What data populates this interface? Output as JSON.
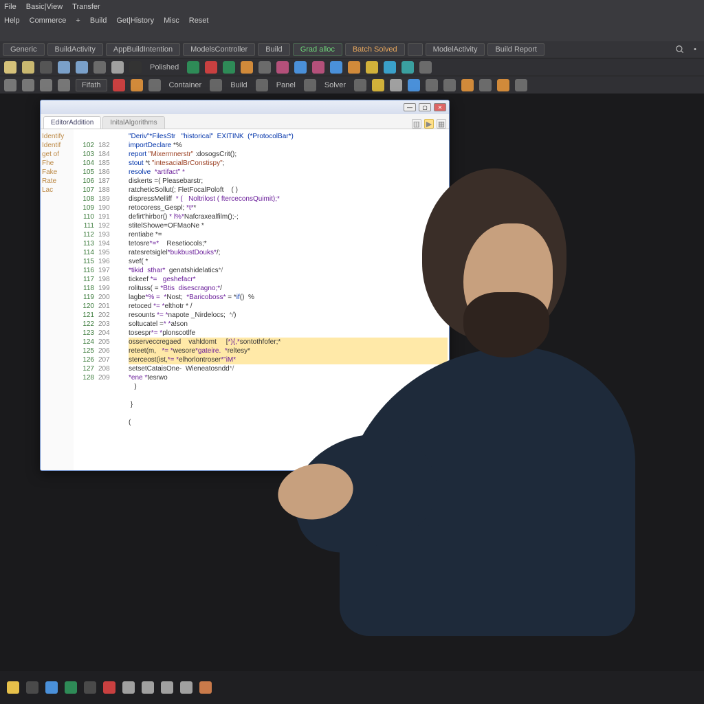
{
  "menubar": {
    "row1": [
      "File",
      "Basic|View",
      "Transfer"
    ],
    "row2": [
      "Help",
      "Commerce",
      "+",
      "Build",
      "Get|History",
      "Misc",
      "Reset"
    ]
  },
  "tabs": [
    {
      "label": "Generic",
      "kind": ""
    },
    {
      "label": "BuildActivity",
      "kind": ""
    },
    {
      "label": "AppBuildIntention",
      "kind": ""
    },
    {
      "label": "ModelsController",
      "kind": ""
    },
    {
      "label": "Build",
      "kind": ""
    },
    {
      "label": "Grad alloc",
      "kind": "active-green"
    },
    {
      "label": "Batch Solved",
      "kind": "active-orange"
    },
    {
      "label": "",
      "kind": ""
    },
    {
      "label": "ModelActivity",
      "kind": ""
    },
    {
      "label": "Build Report",
      "kind": ""
    }
  ],
  "search_placeholder": "",
  "toolbar1_chips": [
    "#d6c27a",
    "#c9b870",
    "#555",
    "#7aa0c9",
    "#7aa0c9",
    "#6b6b6b",
    "#a0a0a0",
    "#333",
    "#2e8b57",
    "#c94040",
    "#2e8b57",
    "#d18a3a",
    "#6b6b6b",
    "#b4507a",
    "#4a90d9",
    "#b4507a",
    "#4a90d9",
    "#d18a3a",
    "#d1b13a",
    "#3aa0c9",
    "#3aa0a0",
    "#6b6b6b"
  ],
  "toolbar1_label": "Polished",
  "toolbar2": {
    "chips_left": [
      "#777",
      "#777",
      "#777",
      "#777"
    ],
    "btn1": "Fifath",
    "chips_mid": [
      "#c94040",
      "#d18a3a",
      "#6b6b6b"
    ],
    "labels": [
      "Container",
      "Build",
      "Panel",
      "Solver"
    ],
    "chips_right": [
      "#d1b13a",
      "#a0a0a0",
      "#4a90d9",
      "#6b6b6b",
      "#6b6b6b",
      "#d18a3a",
      "#6b6b6b",
      "#d18a3a",
      "#6b6b6b"
    ]
  },
  "codewin": {
    "tabs": [
      {
        "label": "EditorAddition",
        "active": true
      },
      {
        "label": "InitalAlgorithms",
        "active": false
      }
    ],
    "outer_gutter": [
      "Identify",
      "Identif",
      "get of",
      "Fhe",
      "Fake",
      "Rate",
      "Lac"
    ],
    "header_line": "\"Deriv\"*FilesStr   \"historical\"  EXITINK  (*ProtocolBar*)",
    "lines": [
      {
        "ln": "102",
        "ln2": "182",
        "c": "importDeclare *%"
      },
      {
        "ln": "103",
        "ln2": "184",
        "c": "report \"Mixermnerstr\" :dosogsCrit();"
      },
      {
        "ln": "104",
        "ln2": "185",
        "c": "stout *t \"intesacialBrConstispy\";"
      },
      {
        "ln": "105",
        "ln2": "186",
        "c": "resolve  *artifact\" *"
      },
      {
        "ln": "106",
        "ln2": "187",
        "c": "diskerts =( Pleasebarstr;"
      },
      {
        "ln": "107",
        "ln2": "188",
        "c": "ratcheticSollut(; FletFocalPoloft    ( )"
      },
      {
        "ln": "108",
        "ln2": "189",
        "c": "dispressMelliff  * (   Noltrilost ( fterceconsQuimit);*"
      },
      {
        "ln": "109",
        "ln2": "190",
        "c": "retocoress_Gespl; *t**"
      },
      {
        "ln": "110",
        "ln2": "191",
        "c": "defirt'hirbor() * l%*Nafcraxealfilm();-;"
      },
      {
        "ln": "111",
        "ln2": "192",
        "c": "stitelShowe=OFMaoNe *"
      },
      {
        "ln": "112",
        "ln2": "193",
        "c": "rentiabe *="
      },
      {
        "ln": "113",
        "ln2": "194",
        "c": "tetosre*=*    Resetiocols;*"
      },
      {
        "ln": "114",
        "ln2": "195",
        "c": "ratesretsiglel*bukbustDouks*/;"
      },
      {
        "ln": "115",
        "ln2": "196",
        "c": "svef( *"
      },
      {
        "ln": "116",
        "ln2": "197",
        "c": "*tikid  sthar*  genatshidelatics*/"
      },
      {
        "ln": "117",
        "ln2": "198",
        "c": "tickeef *=   geshefacr*"
      },
      {
        "ln": "118",
        "ln2": "199",
        "c": "rolituss( = *Btis  disescragno;*/"
      },
      {
        "ln": "119",
        "ln2": "200",
        "c": "lagbe*% =  *Nost;  *Baricoboss* = *if()  %"
      },
      {
        "ln": "120",
        "ln2": "201",
        "c": "retoced *= *elthotr * /"
      },
      {
        "ln": "121",
        "ln2": "202",
        "c": "resounts *= *napote _Nirdelocs;  */)"
      },
      {
        "ln": "122",
        "ln2": "203",
        "c": "soltucatel =* *a!son"
      },
      {
        "ln": "123",
        "ln2": "204",
        "c": "tosespr*= *plonscotlfe"
      },
      {
        "ln": "124",
        "ln2": "205",
        "c": "osserveccregaed    vahldomt     [*){,*sontothfofer;*"
      },
      {
        "ln": "125",
        "ln2": "206",
        "c": "reteet(m,   *= *wesore*gateire.  *reltesy*"
      },
      {
        "ln": "126",
        "ln2": "207",
        "c": "sterceost(ist,*= *elhorlontroser*\"iM*"
      },
      {
        "ln": "127",
        "ln2": "208",
        "c": "setsetCataisOne-  Wieneatosndd*/"
      },
      {
        "ln": "128",
        "ln2": "209",
        "c": "*ene *tesrwo"
      },
      {
        "ln": "",
        "ln2": "",
        "c": "   )"
      },
      {
        "ln": "",
        "ln2": "",
        "c": ""
      },
      {
        "ln": "",
        "ln2": "",
        "c": " }"
      },
      {
        "ln": "",
        "ln2": "",
        "c": ""
      },
      {
        "ln": "",
        "ln2": "",
        "c": "("
      }
    ]
  },
  "taskbar_icons": [
    "#e6c04a",
    "#4a4a4a",
    "#4a90d9",
    "#2e8b57",
    "#4a4a4a",
    "#c94040",
    "#a0a0a0",
    "#a0a0a0",
    "#a0a0a0",
    "#a0a0a0",
    "#c97a4a"
  ]
}
